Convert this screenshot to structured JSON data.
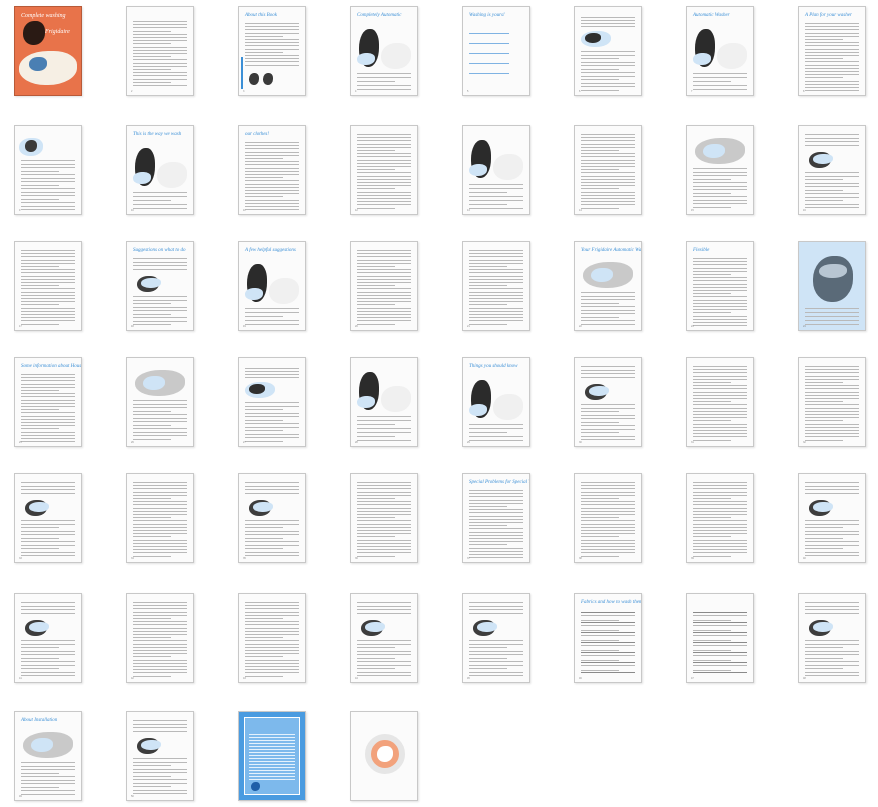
{
  "document": {
    "cover_heading": "Complete washing",
    "cover_brand": "Frigidaire",
    "page_count": 52,
    "columns": 8,
    "headings": {
      "3": "About this Book",
      "4": "Completely Automatic",
      "5": "Washing is yours!",
      "7": "Automatic Washer",
      "8": "A Plan for your washer",
      "10": "This is the way we wash",
      "11": "our clothes!",
      "18": "Suggestions on what to do",
      "19": "A few helpful suggestions",
      "22": "Your Frigidaire Automatic Washer",
      "23": "Flexible",
      "25": "Some information about Household Water",
      "29": "Things you should know",
      "37": "Special Problems for Special Things",
      "46": "Fabrics and how to wash them",
      "49": "About Installation",
      "51": "Frigidaire Warranty"
    }
  },
  "colors": {
    "cover_orange": "#e8734a",
    "accent_blue": "#3b8fd6",
    "light_blue": "#cfe4f6",
    "ink": "#1b1b1b",
    "line": "#b9b9b9",
    "peach": "#f2a27c"
  }
}
